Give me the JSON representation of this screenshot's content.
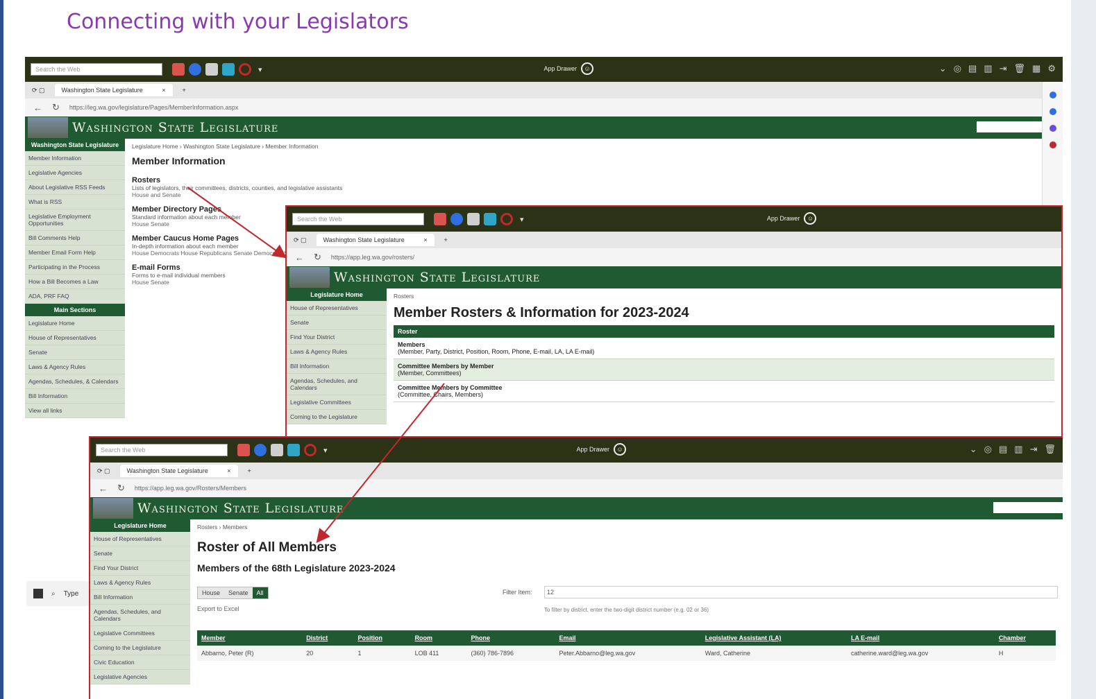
{
  "slide": {
    "title": "Connecting with your Legislators"
  },
  "toolbar": {
    "search_placeholder": "Search the Web",
    "app_drawer": "App Drawer"
  },
  "s1": {
    "tab_title": "Washington State Legislature",
    "url": "https://leg.wa.gov/legislature/Pages/MemberInformation.aspx",
    "brand": "Washington State Legislature",
    "nav_head_1": "Washington State Legislature",
    "nav_items_1": [
      "Member Information",
      "Legislative Agencies",
      "About Legislative RSS Feeds",
      "What is RSS",
      "Legislative Employment Opportunities",
      "Bill Comments Help",
      "Member Email Form Help",
      "Participating in the Process",
      "How a Bill Becomes a Law",
      "ADA, PRF FAQ"
    ],
    "nav_head_2": "Main Sections",
    "nav_items_2": [
      "Legislature Home",
      "House of Representatives",
      "Senate",
      "Laws & Agency Rules",
      "Agendas, Schedules, & Calendars",
      "Bill Information",
      "View all links"
    ],
    "crumb": "Legislature Home › Washington State Legislature › Member Information",
    "heading": "Member Information",
    "sections": [
      {
        "title": "Rosters",
        "desc": "Lists of legislators, their committees, districts, counties, and legislative assistants",
        "links": "House and Senate"
      },
      {
        "title": "Member Directory Pages",
        "desc": "Standard information about each member",
        "links": "House   Senate"
      },
      {
        "title": "Member Caucus Home Pages",
        "desc": "In-depth information about each member",
        "links": "House Democrats   House Republicans   Senate Democrats   Senate Republicans"
      },
      {
        "title": "E-mail Forms",
        "desc": "Forms to e-mail individual members",
        "links": "House   Senate"
      }
    ]
  },
  "s2": {
    "tab_title": "Washington State Legislature",
    "url": "https://app.leg.wa.gov/rosters/",
    "brand": "Washington State Legislature",
    "nav_head": "Legislature Home",
    "nav_items": [
      "House of Representatives",
      "Senate",
      "Find Your District",
      "Laws & Agency Rules",
      "Bill Information",
      "Agendas, Schedules, and Calendars",
      "Legislative Committees",
      "Coming to the Legislature"
    ],
    "crumb": "Rosters",
    "heading": "Member Rosters & Information for 2023-2024",
    "table_head": "Roster",
    "rows": [
      {
        "title": "Members",
        "desc": "(Member, Party, District, Position, Room, Phone, E-mail, LA, LA E-mail)"
      },
      {
        "title": "Committee Members by Member",
        "desc": "(Member, Committees)"
      },
      {
        "title": "Committee Members by Committee",
        "desc": "(Committee, Chairs, Members)"
      }
    ]
  },
  "s3": {
    "tab_title": "Washington State Legislature",
    "url": "https://app.leg.wa.gov/Rosters/Members",
    "brand": "Washington State Legislature",
    "nav_head": "Legislature Home",
    "nav_items": [
      "House of Representatives",
      "Senate",
      "Find Your District",
      "Laws & Agency Rules",
      "Bill Information",
      "Agendas, Schedules, and Calendars",
      "Legislative Committees",
      "Coming to the Legislature",
      "Civic Education",
      "Legislative Agencies"
    ],
    "crumb": "Rosters › Members",
    "heading": "Roster of All Members",
    "subheading": "Members of the 68th Legislature 2023-2024",
    "toggles": [
      "House",
      "Senate",
      "All"
    ],
    "filter_label": "Filter Item:",
    "filter_value": "12",
    "export": "Export to Excel",
    "hint": "To filter by district, enter the two-digit district number (e.g. 02 or 36)",
    "columns": [
      "Member",
      "District",
      "Position",
      "Room",
      "Phone",
      "Email",
      "Legislative Assistant (LA)",
      "LA E-mail",
      "Chamber"
    ],
    "rows": [
      [
        "Abbarno, Peter (R)",
        "20",
        "1",
        "LOB 411",
        "(360) 786-7896",
        "Peter.Abbarno@leg.wa.gov",
        "Ward, Catherine",
        "catherine.ward@leg.wa.gov",
        "H"
      ]
    ]
  },
  "taskbar": {
    "search_text": "Type"
  },
  "colors": {
    "title": "#8a3ab0",
    "banner": "#1f5a33",
    "toolbar": "#2c3216",
    "highlight": "#c0282d"
  }
}
